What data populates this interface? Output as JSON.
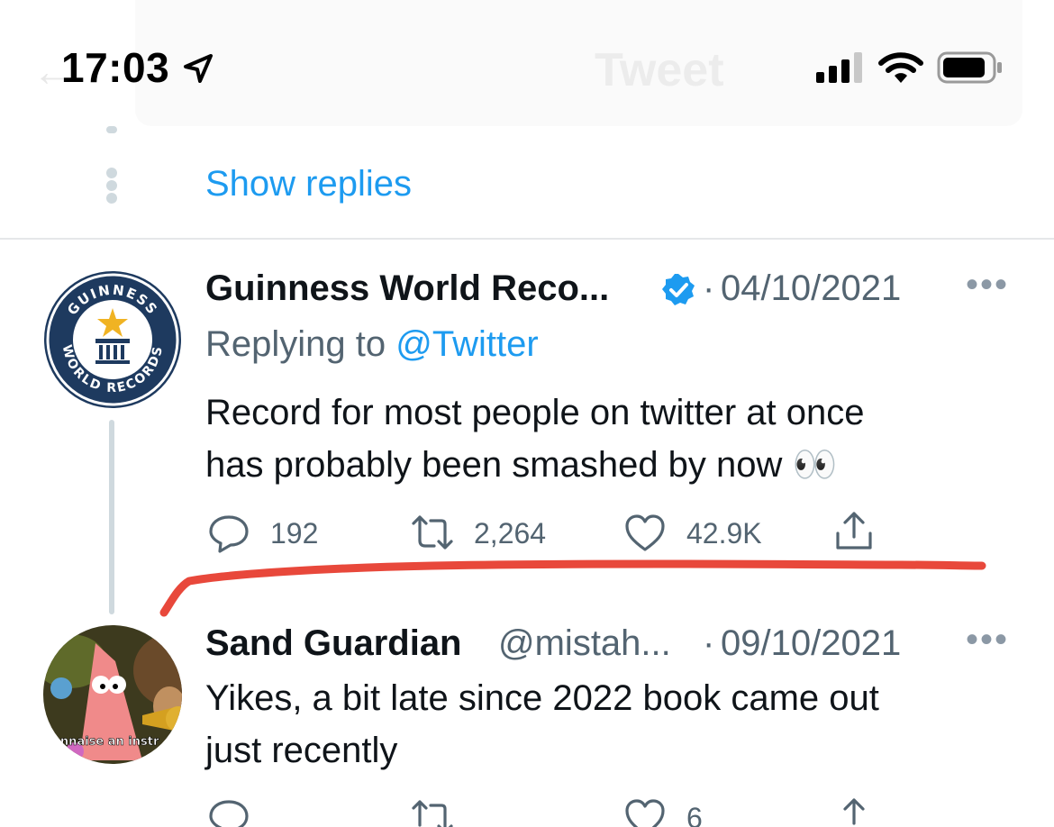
{
  "status_bar": {
    "time": "17:03",
    "icons": [
      "location-arrow-icon",
      "cellular-signal-icon",
      "wifi-icon",
      "battery-icon"
    ]
  },
  "header": {
    "back_icon": "back-arrow-icon",
    "title": "Tweet"
  },
  "thread": {
    "show_replies": "Show replies"
  },
  "tweets": [
    {
      "name": "Guinness World Reco...",
      "verified": true,
      "separator": "·",
      "date": "04/10/2021",
      "replying_prefix": "Replying to ",
      "replying_to": "@Twitter",
      "text_line1": "Record for most people on twitter at once",
      "text_line2": "has probably been smashed by now 👀",
      "replies": "192",
      "retweets": "2,264",
      "likes": "42.9K",
      "avatar_text_top": "GUINNESS",
      "avatar_text_bottom": "WORLD RECORDS"
    },
    {
      "name": "Sand Guardian",
      "handle": "@mistah...",
      "separator": "·",
      "date": "09/10/2021",
      "text_line1": "Yikes, a bit late since 2022 book came out",
      "text_line2": "just recently",
      "likes": "6",
      "avatar_caption": "onnaise an instr"
    }
  ],
  "colors": {
    "accent": "#1d9bf0",
    "annotation": "#e8483b",
    "secondary_text": "#536471"
  }
}
